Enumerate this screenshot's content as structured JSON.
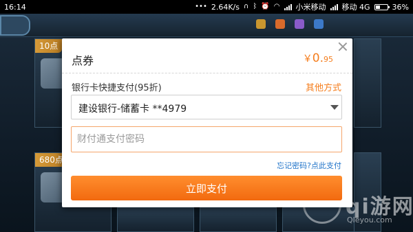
{
  "status_bar": {
    "time": "16:14",
    "network_speed": "2.64K/s",
    "carrier1": "小米移动",
    "carrier2": "移动 4G",
    "battery": "36%",
    "battery_level": 0.36
  },
  "background": {
    "card_label_1": "10点",
    "card_label_2": "680点"
  },
  "dialog": {
    "title": "点券",
    "price_symbol": "￥",
    "price_int": "0.",
    "price_dec": "95",
    "payment_method_label": "银行卡快捷支付(95折)",
    "other_methods_label": "其他方式",
    "selected_card": "建设银行-储蓄卡 **4979",
    "password_placeholder": "财付通支付密码",
    "password_value": "",
    "forgot_password_label": "忘记密码?点此支付",
    "pay_button_label": "立即支付",
    "accent_color": "#f57d1c"
  },
  "watermark": {
    "name": "qi游网",
    "url": "Qleyou.com"
  },
  "icons": [
    "close-icon",
    "dropdown-arrow-icon",
    "bluetooth-icon",
    "alarm-icon",
    "wifi-icon",
    "signal-icon",
    "battery-icon"
  ]
}
